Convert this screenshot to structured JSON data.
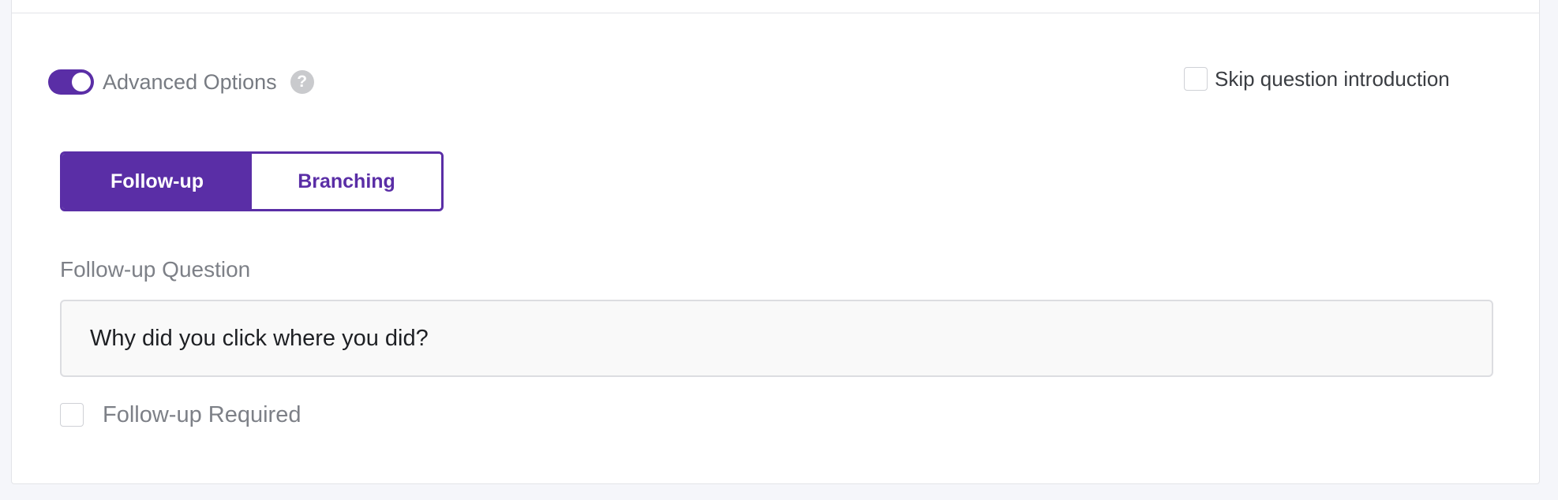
{
  "advanced_options": {
    "label": "Advanced Options",
    "enabled": true,
    "help_glyph": "?"
  },
  "skip_intro": {
    "label": "Skip question introduction",
    "checked": false
  },
  "mode_tabs": {
    "follow_up_label": "Follow-up",
    "branching_label": "Branching",
    "selected": "Follow-up"
  },
  "follow_up_question": {
    "label": "Follow-up Question",
    "value": "Why did you click where you did?"
  },
  "follow_up_required": {
    "label": "Follow-up Required",
    "checked": false
  },
  "colors": {
    "accent": "#5a2ea6",
    "muted_text": "#7d8087",
    "page_background": "#f5f6fa"
  },
  "icons": [
    "help-icon"
  ]
}
